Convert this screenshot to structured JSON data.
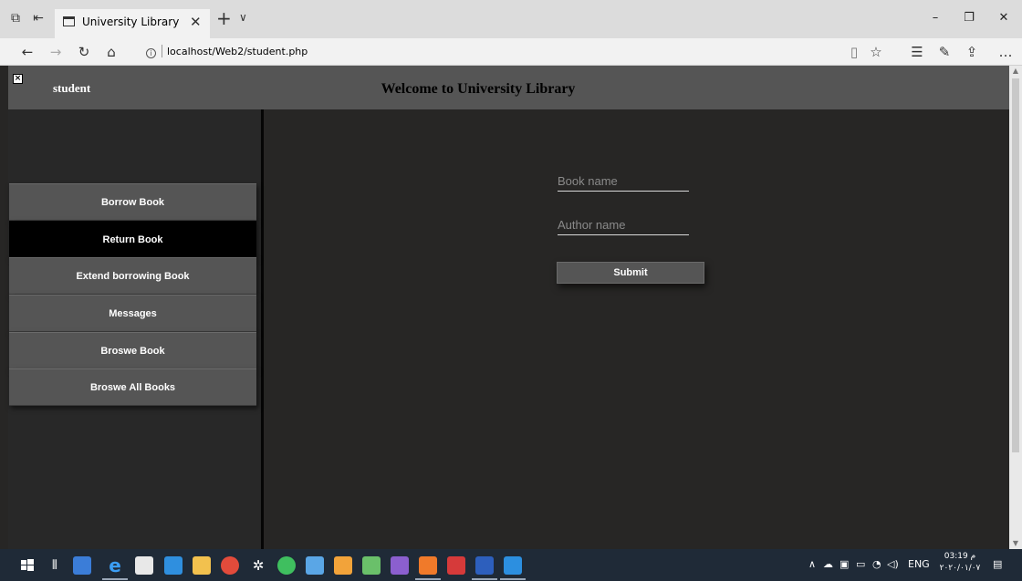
{
  "browser": {
    "tab_title": "University Library",
    "url": "localhost/Web2/student.php"
  },
  "header": {
    "user_label": "student",
    "title": "Welcome to University Library"
  },
  "sidebar": {
    "items": [
      {
        "label": "Borrow Book"
      },
      {
        "label": "Return Book"
      },
      {
        "label": "Extend borrowing Book"
      },
      {
        "label": "Messages"
      },
      {
        "label": "Broswe Book"
      },
      {
        "label": "Broswe All Books"
      }
    ],
    "active_index": 1
  },
  "form": {
    "book_placeholder": "Book name",
    "author_placeholder": "Author name",
    "submit_label": "Submit"
  },
  "taskbar": {
    "lang": "ENG",
    "time": "03:19 م",
    "date": "٢٠٢٠/٠١/٠٧"
  },
  "colors": {
    "header_bg": "#555555",
    "content_bg": "#272625",
    "button_bg": "#555555",
    "active_item_bg": "#000000"
  }
}
